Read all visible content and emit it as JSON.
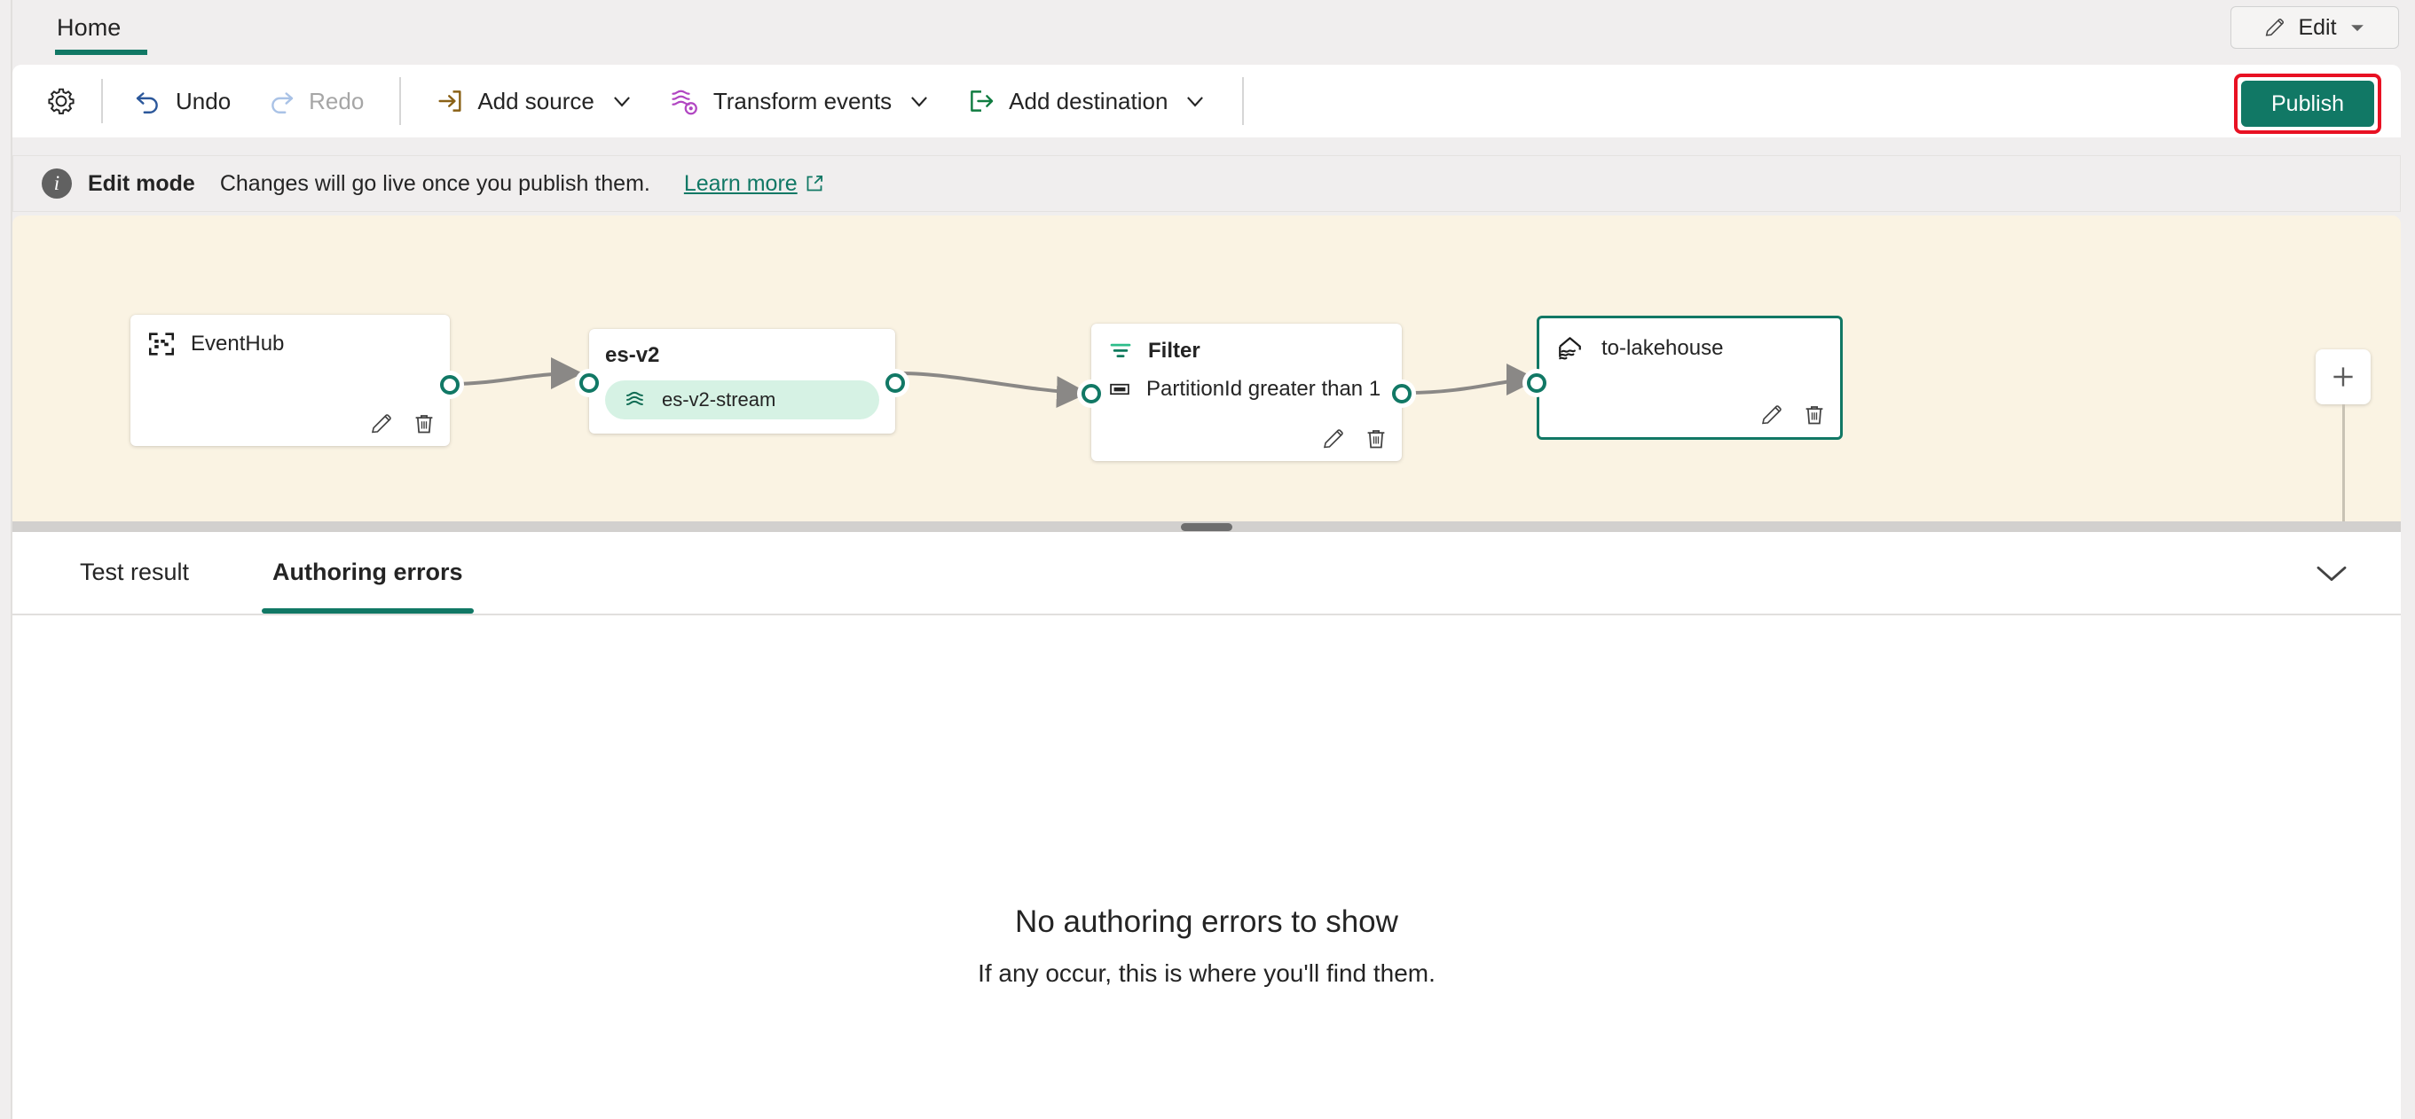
{
  "ribbon": {
    "tabs": [
      {
        "label": "Home",
        "active": true
      }
    ],
    "edit_button": {
      "label": "Edit",
      "icon": "pencil-icon",
      "chevron": "▼"
    }
  },
  "toolbar": {
    "settings_icon": "gear-icon",
    "items": [
      {
        "label": "Undo",
        "icon": "undo-icon",
        "disabled": false
      },
      {
        "label": "Redo",
        "icon": "redo-icon",
        "disabled": true
      },
      {
        "label": "Add source",
        "icon": "add-source-icon",
        "chevron": "∨"
      },
      {
        "label": "Transform events",
        "icon": "transform-events-icon",
        "chevron": "∨"
      },
      {
        "label": "Add destination",
        "icon": "add-destination-icon",
        "chevron": "∨"
      }
    ],
    "publish": {
      "label": "Publish",
      "bg": "#117865",
      "highlight": "#e81123"
    }
  },
  "info_bar": {
    "icon": "info-icon",
    "badge": "i",
    "title": "Edit mode",
    "message": "Changes will go live once you publish them.",
    "link": {
      "label": "Learn more",
      "icon": "external-link-icon"
    }
  },
  "canvas": {
    "background": "#faf3e3",
    "add_node_button": {
      "icon": "plus-icon"
    },
    "nodes": [
      {
        "id": "eventhub",
        "title": "EventHub",
        "icon": "eventhub-icon",
        "bold": false,
        "selected": false,
        "actions": [
          "edit-pencil-icon",
          "delete-trash-icon"
        ]
      },
      {
        "id": "es-v2",
        "title": "es-v2",
        "icon": null,
        "bold": true,
        "selected": false,
        "stream": {
          "label": "es-v2-stream",
          "icon": "eventstream-icon",
          "bg": "#d6f2e4"
        }
      },
      {
        "id": "filter",
        "title": "Filter",
        "icon": "filter-icon",
        "bold": true,
        "selected": false,
        "condition": {
          "label": "PartitionId greater than 1",
          "icon": "condition-icon"
        },
        "actions": [
          "edit-pencil-icon",
          "delete-trash-icon"
        ]
      },
      {
        "id": "to-lakehouse",
        "title": "to-lakehouse",
        "icon": "lakehouse-icon",
        "bold": false,
        "selected": true,
        "selected_color": "#117865",
        "actions": [
          "edit-pencil-icon",
          "delete-trash-icon"
        ]
      }
    ],
    "resize_handle": "panel-resize-grip"
  },
  "bottom_panel": {
    "tabs": [
      {
        "label": "Test result",
        "active": false
      },
      {
        "label": "Authoring errors",
        "active": true
      }
    ],
    "collapse_icon": "chevron-down-icon",
    "empty_state": {
      "title": "No authoring errors to show",
      "subtitle": "If any occur, this is where you'll find them."
    }
  }
}
